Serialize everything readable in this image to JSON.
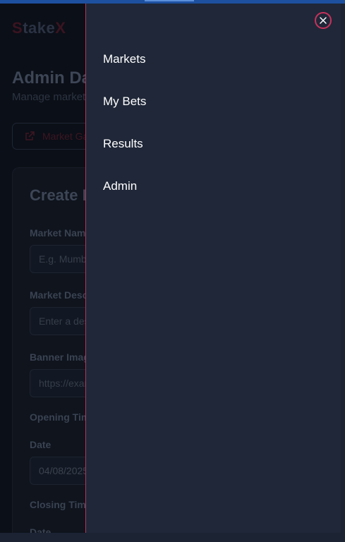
{
  "app": {
    "logo_first": "S",
    "logo_middle": "take",
    "logo_last": "X"
  },
  "page": {
    "title": "Admin Dashboard",
    "subtitle": "Manage markets"
  },
  "game_button": {
    "label": "Market Games",
    "icon": "external-link-icon"
  },
  "form": {
    "title": "Create Market",
    "market_name_label": "Market Name",
    "market_name_placeholder": "E.g. Mumbai Main",
    "market_desc_label": "Market Description",
    "market_desc_placeholder": "Enter a description",
    "banner_label": "Banner Image",
    "banner_placeholder": "https://example.com/banner.png",
    "opening_time_label": "Opening Time",
    "opening_date_label": "Date",
    "opening_date_value": "04/08/2025",
    "closing_time_label": "Closing Time",
    "closing_date_label": "Date"
  },
  "drawer": {
    "close_icon": "close-icon",
    "items": [
      {
        "label": "Markets"
      },
      {
        "label": "My Bets"
      },
      {
        "label": "Results"
      },
      {
        "label": "Admin"
      }
    ]
  },
  "colors": {
    "drawer_bg": "#1f2738",
    "accent": "#c8325c",
    "frame_bg": "#0b0f17",
    "topbar": "#1e50a0"
  }
}
